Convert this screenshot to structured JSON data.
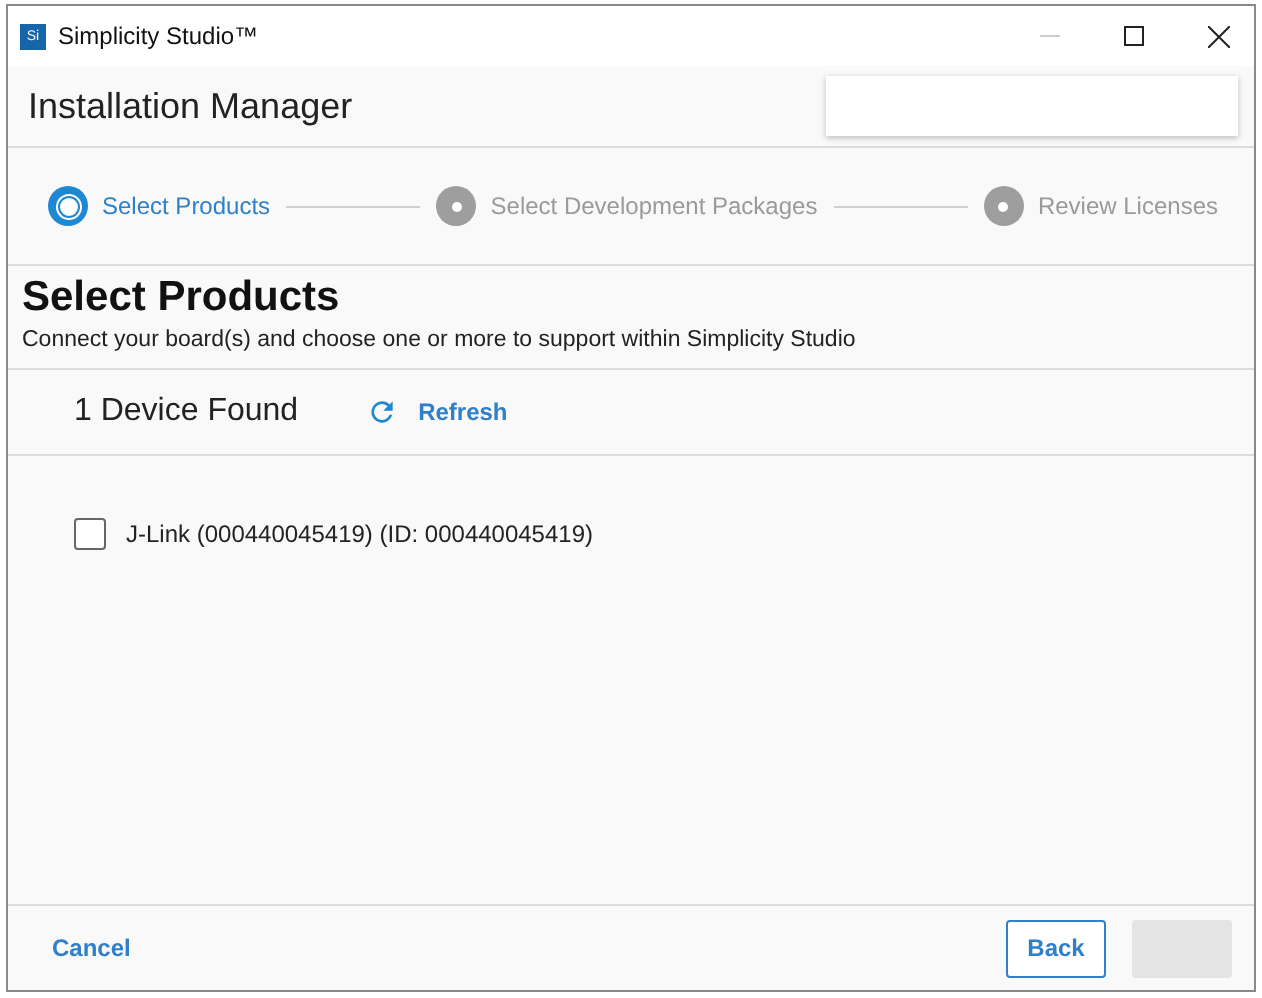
{
  "window": {
    "title": "Simplicity Studio™",
    "app_icon": "Si"
  },
  "header": {
    "title": "Installation Manager"
  },
  "steps": [
    {
      "label": "Select Products",
      "selected": true
    },
    {
      "label": "Select Development Packages",
      "selected": false
    },
    {
      "label": "Review Licenses",
      "selected": false
    }
  ],
  "page": {
    "title": "Select Products",
    "subtitle": "Connect your board(s) and choose one or more to support within Simplicity Studio"
  },
  "devices_bar": {
    "count": "1 Device Found",
    "refresh": "Refresh"
  },
  "devices": [
    {
      "label": "J-Link (000440045419) (ID: 000440045419)",
      "checked": false
    }
  ],
  "footer": {
    "cancel": "Cancel",
    "back": "Back",
    "next_disabled": true
  }
}
